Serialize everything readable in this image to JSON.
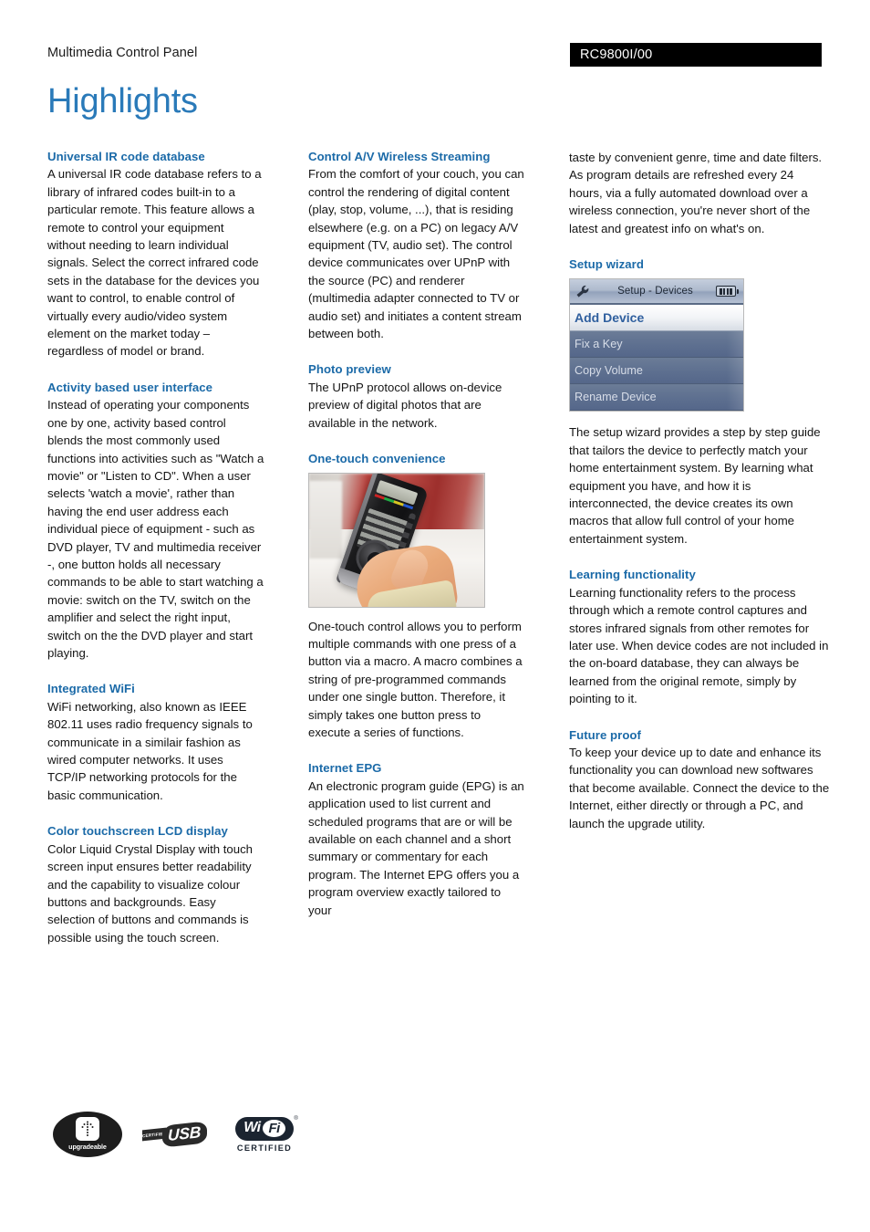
{
  "header": {
    "left_label": "Multimedia Control Panel",
    "model": "RC9800I/00"
  },
  "title": "Highlights",
  "accent_color": "#2a7ab9",
  "heading_color": "#1b6aa8",
  "columns": [
    {
      "features": [
        {
          "title": "Universal IR code database",
          "body": "A universal IR code database refers to a library of infrared codes built-in to a particular remote. This feature allows a remote to control your equipment without needing to learn individual signals. Select the correct infrared code sets in the database for the devices you want to control, to enable control of virtually every audio/video system element on the market today – regardless of model or brand."
        },
        {
          "title": "Activity based user interface",
          "body": "Instead of operating your components one by one, activity based control blends the most commonly used functions into activities such as \"Watch a movie\" or \"Listen to CD\". When a user selects 'watch a movie', rather than having the end user address each individual piece of equipment - such as DVD player, TV and multimedia receiver -, one button holds all necessary commands to be able to start watching a movie: switch on the TV, switch on the amplifier and select the right input, switch on the the DVD player and start playing."
        },
        {
          "title": "Integrated WiFi",
          "body": "WiFi networking, also known as IEEE 802.11 uses radio frequency signals to communicate in a similair fashion as wired computer networks. It uses TCP/IP networking protocols for the basic communication."
        },
        {
          "title": "Color touchscreen LCD display",
          "body": "Color Liquid Crystal Display with touch screen input ensures better readability and the capability to visualize colour buttons and backgrounds. Easy selection of buttons and commands is possible using the touch screen."
        }
      ]
    },
    {
      "features": [
        {
          "title": "Control A/V Wireless Streaming",
          "body": "From the comfort of your couch, you can control the rendering of digital content (play, stop, volume, ...), that is residing elsewhere (e.g. on a PC) on legacy A/V equipment (TV, audio set). The control device communicates over UPnP with the source (PC) and renderer (multimedia adapter connected to TV or audio set) and initiates a content stream between both."
        },
        {
          "title": "Photo preview",
          "body": "The UPnP protocol allows on-device preview of digital photos that are available in the network."
        },
        {
          "title": "One-touch convenience",
          "image": "remote-control-in-hand-photo",
          "body": "One-touch control allows you to perform multiple commands with one press of a button via a macro. A macro combines a string of pre-programmed commands under one single button. Therefore, it simply takes one button press to execute a series of functions."
        },
        {
          "title": "Internet EPG",
          "body": "An electronic program guide (EPG) is an application used to list current and scheduled programs that are or will be available on each channel and a short summary or commentary for each program. The Internet EPG offers you a program overview exactly tailored to your"
        }
      ]
    },
    {
      "features": [
        {
          "title": "",
          "body": "taste by convenient genre, time and date filters. As program details are refreshed every 24 hours, via a fully automated download over a wireless connection, you're never short of the latest and greatest info on what's on."
        },
        {
          "title": "Setup wizard",
          "image": "setup-wizard-device-screenshot",
          "body": "The setup wizard provides a step by step guide that tailors the device to perfectly match your home entertainment system. By learning what equipment you have, and how it is interconnected, the device creates its own macros that allow full control of your home entertainment system."
        },
        {
          "title": "Learning functionality",
          "body": "Learning functionality refers to the process through which a remote control captures and stores infrared signals from other remotes for later use. When device codes are not included in the on-board database, they can always be learned from the original remote, simply by pointing to it."
        },
        {
          "title": "Future proof",
          "body": "To keep your device up to date and enhance its functionality you can download new softwares that become available. Connect the device to the Internet, either directly or through a PC, and launch the upgrade utility."
        }
      ]
    }
  ],
  "wizard_screenshot": {
    "title": "Setup - Devices",
    "battery_icon": "battery-full-icon",
    "wrench_icon": "wrench-icon",
    "rows": [
      {
        "label": "Add Device",
        "selected": true
      },
      {
        "label": "Fix a Key",
        "selected": false
      },
      {
        "label": "Copy Volume",
        "selected": false
      },
      {
        "label": "Rename Device",
        "selected": false
      }
    ]
  },
  "footer_logos": [
    {
      "name": "upgradeable-logo",
      "caption": "upgradeable"
    },
    {
      "name": "usb-logo",
      "small_text": "CERTIFIED",
      "main_text": "USB"
    },
    {
      "name": "wifi-certified-logo",
      "wi": "Wi",
      "fi": "Fi",
      "caption": "CERTIFIED",
      "registered": "®"
    }
  ]
}
